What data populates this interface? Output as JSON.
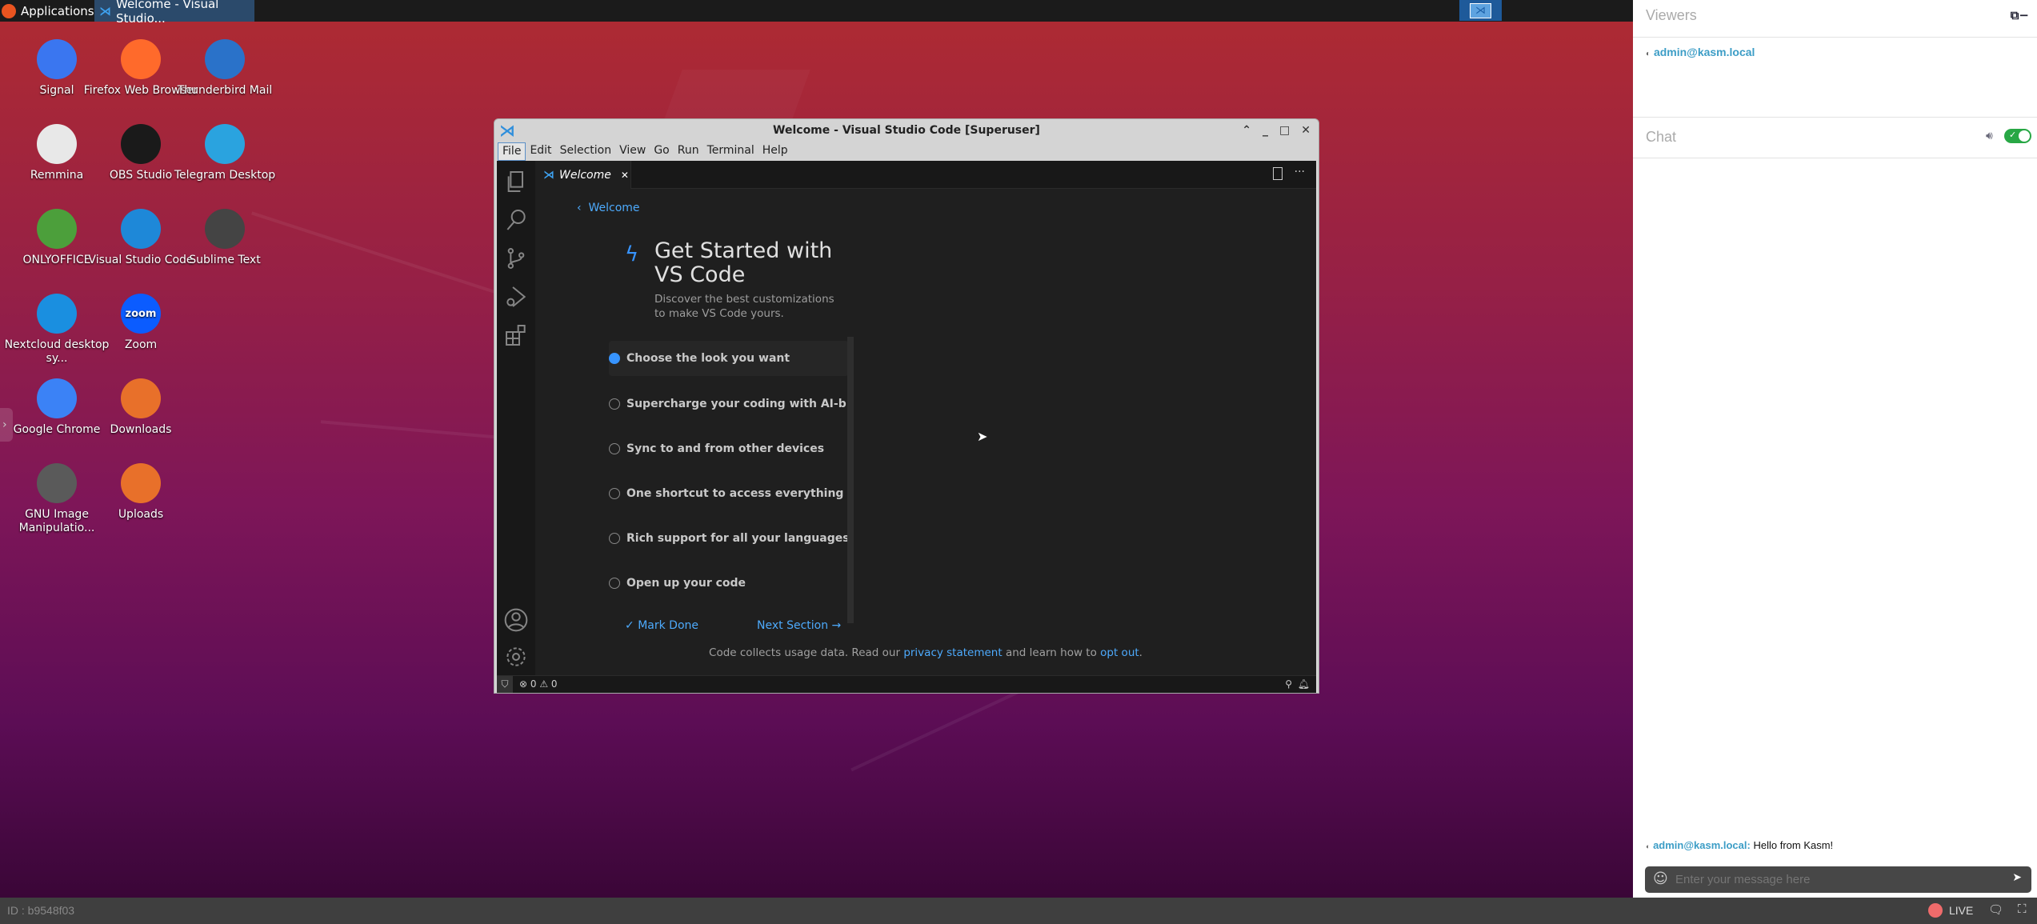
{
  "taskbar": {
    "apps_label": "Applications",
    "task_label": "Welcome - Visual Studio..."
  },
  "desktop_icons": [
    {
      "label": "Signal",
      "color": "#3a76f0"
    },
    {
      "label": "Firefox Web Browser",
      "color": "#ff6a2b"
    },
    {
      "label": "Thunderbird Mail",
      "color": "#2a72c9"
    },
    {
      "label": "Remmina",
      "color": "#e8e8e8"
    },
    {
      "label": "OBS Studio",
      "color": "#1a1a1a"
    },
    {
      "label": "Telegram Desktop",
      "color": "#2aa3df"
    },
    {
      "label": "ONLYOFFICE",
      "color": "#4c9f3b"
    },
    {
      "label": "Visual Studio Code",
      "color": "#1e88d8"
    },
    {
      "label": "Sublime Text",
      "color": "#444"
    },
    {
      "label": "Nextcloud desktop sy...",
      "color": "#1a8fe0"
    },
    {
      "label": "Zoom",
      "color": "#0b5cff",
      "glyph": "zoom"
    },
    {
      "label": "Google Chrome",
      "color": "#3b82f6"
    },
    {
      "label": "Downloads",
      "color": "#e8702a"
    },
    {
      "label": "GNU Image Manipulatio...",
      "color": "#5a5a5a"
    },
    {
      "label": "Uploads",
      "color": "#e8702a"
    }
  ],
  "vscode": {
    "title": "Welcome - Visual Studio Code [Superuser]",
    "menu": [
      "File",
      "Edit",
      "Selection",
      "View",
      "Go",
      "Run",
      "Terminal",
      "Help"
    ],
    "tab": "Welcome",
    "breadcrumb": "Welcome",
    "heading1": "Get Started with",
    "heading2": "VS Code",
    "desc1": "Discover the best customizations",
    "desc2": "to make VS Code yours.",
    "steps": [
      {
        "label": "Choose the look you want",
        "done": true
      },
      {
        "label": "Supercharge your coding with AI-b...",
        "done": false
      },
      {
        "label": "Sync to and from other devices",
        "done": false
      },
      {
        "label": "One shortcut to access everything",
        "done": false
      },
      {
        "label": "Rich support for all your languages",
        "done": false
      },
      {
        "label": "Open up your code",
        "done": false
      }
    ],
    "mark_done": "Mark Done",
    "next_section": "Next Section →",
    "footer": {
      "pre": "Code collects usage data. Read our",
      "privacy": "privacy statement",
      "mid": "and learn how to",
      "optout": "opt out",
      "post": "."
    },
    "status": {
      "errors": "0",
      "warnings": "0"
    }
  },
  "panel": {
    "viewers_title": "Viewers",
    "viewer": "admin@kasm.local",
    "chat_title": "Chat",
    "sound_enabled": true,
    "message_user": "admin@kasm.local:",
    "message_text": "Hello from Kasm!",
    "input_placeholder": "Enter your message here"
  },
  "bottombar": {
    "id": "ID : b9548f03",
    "live": "LIVE"
  },
  "colors": {
    "accent": "#4daafc",
    "kasm_link": "#3c9dc6",
    "live": "#ef6b6b",
    "toggle": "#28a745"
  }
}
